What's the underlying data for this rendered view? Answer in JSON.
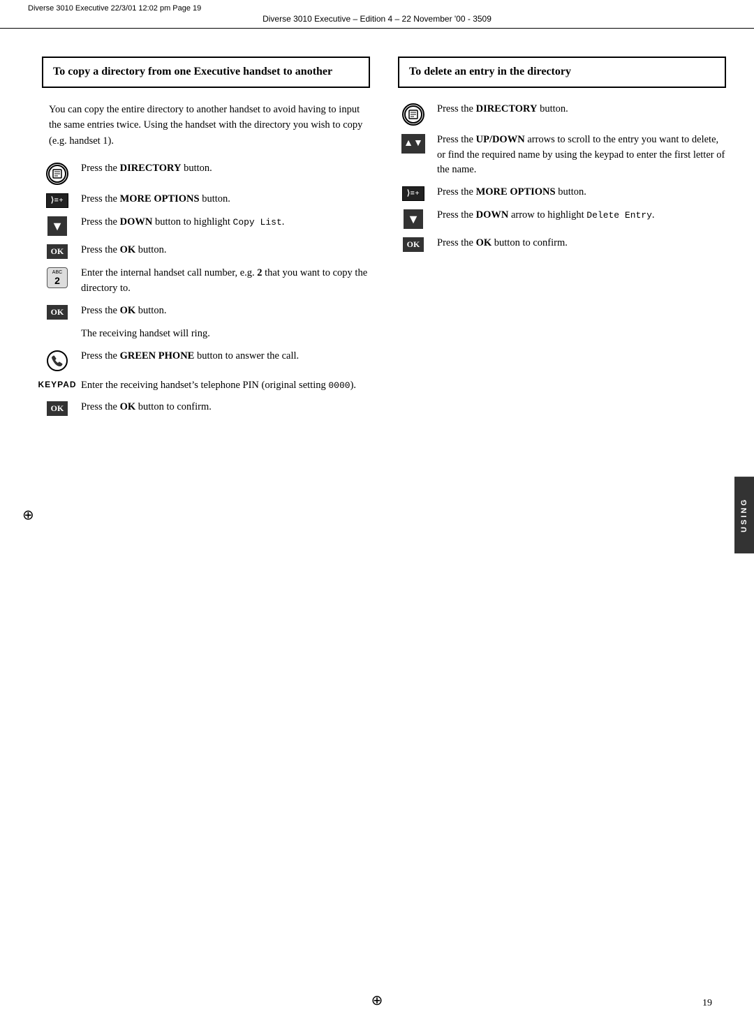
{
  "header": {
    "line1": "Diverse 3010 Executive   22/3/01   12:02 pm   Page 19",
    "line2": "Diverse 3010 Executive – Edition 4 – 22 November '00 - 3509"
  },
  "left_section": {
    "title": "To copy a directory from one Executive handset to another",
    "intro": "You can copy the entire directory to another handset to avoid having to input the same entries twice. Using the handset with the directory you wish to copy (e.g. handset 1).",
    "steps": [
      {
        "icon": "directory",
        "text_before": "Press the ",
        "bold": "DIRECTORY",
        "text_after": " button."
      },
      {
        "icon": "more-options",
        "text_before": "Press the ",
        "bold": "MORE OPTIONS",
        "text_after": " button."
      },
      {
        "icon": "down",
        "text_before": "Press the ",
        "bold": "DOWN",
        "text_after": " button to highlight ",
        "code": "Copy List",
        "text_end": "."
      },
      {
        "icon": "ok",
        "text_before": "Press the ",
        "bold": "OK",
        "text_after": " button."
      },
      {
        "icon": "keypad",
        "text": "Enter the internal handset call number, e.g. ",
        "bold2": "2",
        "text_after": " that you want to copy the directory to."
      },
      {
        "icon": "ok",
        "text_before": "Press the ",
        "bold": "OK",
        "text_after": " button."
      },
      {
        "icon": "none",
        "text": "The receiving handset will ring."
      },
      {
        "icon": "phone",
        "text_before": "Press the ",
        "bold": "GREEN PHONE",
        "text_after": " button to answer the call."
      },
      {
        "icon": "keypad-label",
        "text_before": "Enter the receiving handset’s telephone PIN (original setting ",
        "code": "0000",
        "text_after": ")."
      },
      {
        "icon": "ok",
        "text_before": "Press the ",
        "bold": "OK",
        "text_after": " button to confirm."
      }
    ]
  },
  "right_section": {
    "title": "To delete an entry in the directory",
    "steps": [
      {
        "icon": "directory",
        "text_before": "Press the ",
        "bold": "DIRECTORY",
        "text_after": " button."
      },
      {
        "icon": "updown",
        "text_before": "Press the ",
        "bold": "UP/DOWN",
        "text_after": " arrows to scroll to the entry you want to delete, or find the required name by using the keypad to enter the first letter of the name."
      },
      {
        "icon": "more-options",
        "text_before": "Press the ",
        "bold": "MORE OPTIONS",
        "text_after": " button."
      },
      {
        "icon": "down",
        "text_before": "Press the ",
        "bold": "DOWN",
        "text_after": " arrow to highlight ",
        "code": "Delete Entry",
        "text_end": "."
      },
      {
        "icon": "ok",
        "text_before": "Press the ",
        "bold": "OK",
        "text_after": " button to confirm."
      }
    ]
  },
  "sidebar": {
    "text": "USING"
  },
  "page_number": "19"
}
